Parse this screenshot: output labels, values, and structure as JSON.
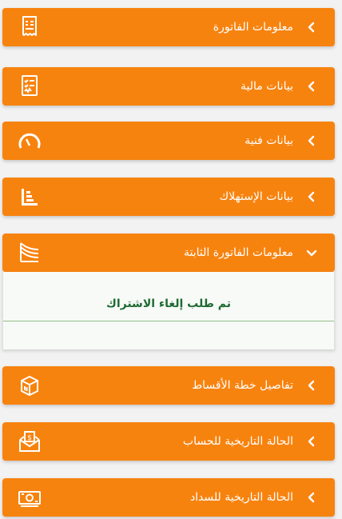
{
  "sections": [
    {
      "label": "معلومات الفاتورة",
      "icon": "invoice-icon",
      "state": "collapsed"
    },
    {
      "label": "بيانات مالية",
      "icon": "financial-list-icon",
      "state": "collapsed"
    },
    {
      "label": "بيانات فنية",
      "icon": "gauge-icon",
      "state": "collapsed"
    },
    {
      "label": "بيانات الإستهلاك",
      "icon": "consumption-bars-icon",
      "state": "collapsed"
    },
    {
      "label": "معلومات الفاتورة الثابتة",
      "icon": "fixed-invoice-icon",
      "state": "expanded"
    },
    {
      "label": "تفاصيل خطة الأقساط",
      "icon": "installments-box-icon",
      "state": "collapsed"
    },
    {
      "label": "الحالة التاريخية للحساب",
      "icon": "envelope-money-icon",
      "state": "collapsed"
    },
    {
      "label": "الحالة التاريخية للسداد",
      "icon": "banknote-icon",
      "state": "collapsed"
    }
  ],
  "expanded_panel": {
    "message": "تم طلب إلغاء الاشتراك"
  },
  "colors": {
    "accent": "#f7830f",
    "panel_text": "#1d6a32",
    "panel_divider": "#8fbf86"
  }
}
